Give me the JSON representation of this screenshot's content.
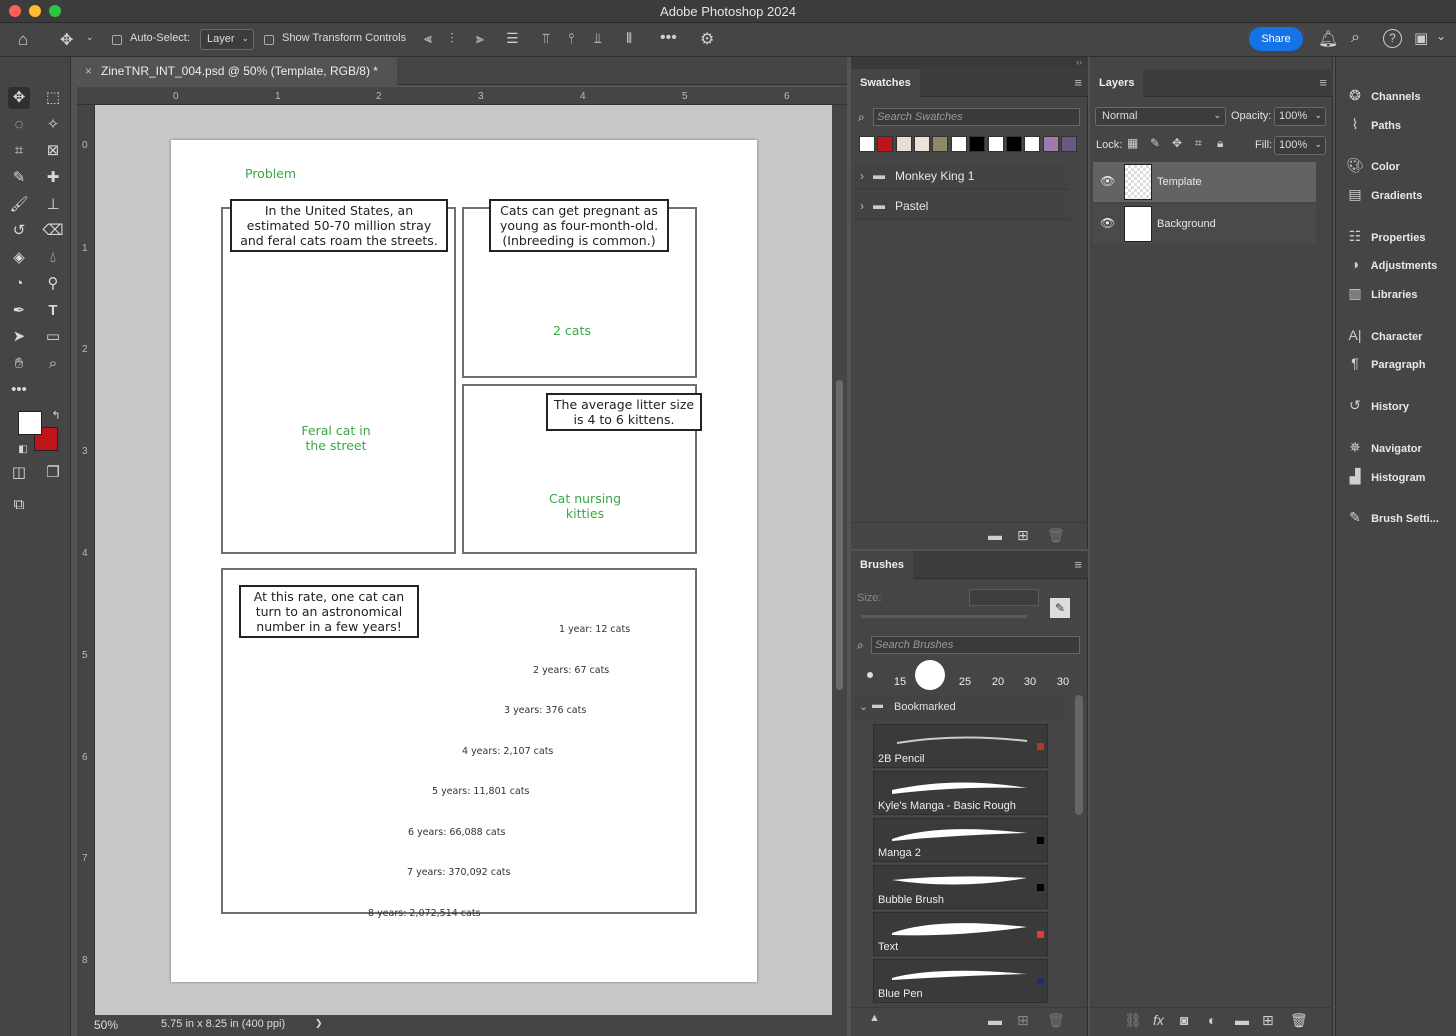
{
  "app": {
    "title": "Adobe Photoshop 2024"
  },
  "options": {
    "auto_select_label": "Auto-Select:",
    "auto_select_value": "Layer",
    "show_transform": "Show Transform Controls",
    "share": "Share"
  },
  "document": {
    "tab_title": "ZineTNR_INT_004.psd @ 50% (Template, RGB/8) *",
    "zoom": "50%",
    "doc_size": "5.75 in x 8.25 in (400 ppi)",
    "chevron": "❯"
  },
  "rulers": {
    "h": [
      "0",
      "1",
      "2",
      "3",
      "4",
      "5",
      "6"
    ],
    "v": [
      "0",
      "1",
      "2",
      "3",
      "4",
      "5",
      "6",
      "7",
      "8"
    ]
  },
  "zine": {
    "problem": "Problem",
    "bubble1": "In the United States, an estimated 50-70 million stray and feral cats roam the streets.",
    "bubble2": "Cats can get pregnant as young as four-month-old. (Inbreeding is common.)",
    "label_two_cats": "2 cats",
    "bubble3": "The average litter size is 4 to 6 kittens.",
    "label_feral": "Feral cat in the street",
    "label_nursing": "Cat nursing kitties",
    "bubble4": "At this rate, one cat can turn to an astronomical number in a few years!",
    "years": [
      "1 year: 12 cats",
      "2 years: 67 cats",
      "3 years: 376 cats",
      "4 years: 2,107 cats",
      "5 years: 11,801 cats",
      "6 years: 66,088 cats",
      "7 years: 370,092 cats",
      "8 years: 2,072,514 cats"
    ]
  },
  "swatches": {
    "title": "Swatches",
    "search_placeholder": "Search Swatches",
    "colors": [
      "#ffffff",
      "#c0141b",
      "#e8e0d4",
      "#ebe3d6",
      "#8e8a68",
      "#ffffff",
      "#000000",
      "#ffffff",
      "#000000",
      "#ffffff",
      "#9b7cad",
      "#6a5880"
    ],
    "groups": [
      "Monkey King 1",
      "Pastel"
    ]
  },
  "layers": {
    "title": "Layers",
    "blend": "Normal",
    "opacity_label": "Opacity:",
    "opacity": "100%",
    "lock_label": "Lock:",
    "fill_label": "Fill:",
    "fill": "100%",
    "items": [
      "Template",
      "Background"
    ]
  },
  "brushes": {
    "title": "Brushes",
    "size_label": "Size:",
    "search_placeholder": "Search Brushes",
    "tips": [
      "15",
      "25",
      "20",
      "30",
      "30"
    ],
    "folder": "Bookmarked",
    "items": [
      {
        "name": "2B Pencil",
        "color": "#b03a20"
      },
      {
        "name": "Kyle's Manga - Basic Rough",
        "color": ""
      },
      {
        "name": "Manga 2",
        "color": "#000000"
      },
      {
        "name": "Bubble Brush",
        "color": "#000000"
      },
      {
        "name": "Text",
        "color": "#e53935"
      },
      {
        "name": "Blue Pen",
        "color": "#1f2e6e"
      }
    ]
  },
  "dock": [
    "Channels",
    "Paths",
    "Color",
    "Gradients",
    "Properties",
    "Adjustments",
    "Libraries",
    "Character",
    "Paragraph",
    "History",
    "Navigator",
    "Histogram",
    "Brush Setti..."
  ],
  "colors": {
    "foreground": "#ffffff",
    "background": "#c0141b",
    "share": "#1473e6"
  }
}
